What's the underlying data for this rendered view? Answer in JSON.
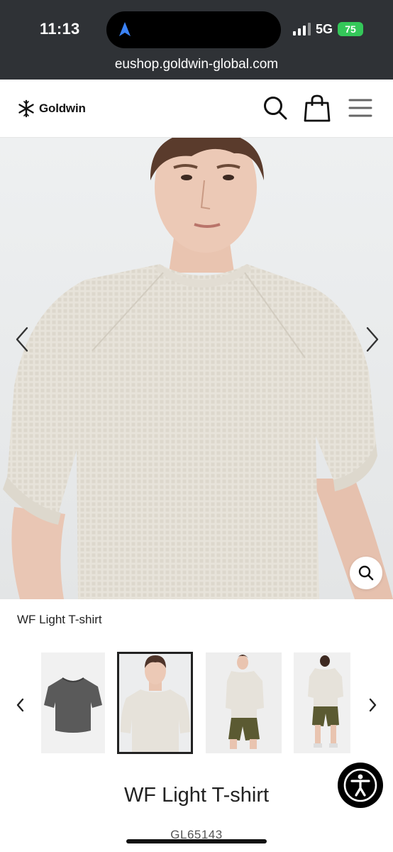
{
  "status_bar": {
    "time": "11:13",
    "network": "5G",
    "battery": "75",
    "url": "eushop.goldwin-global.com"
  },
  "header": {
    "logo_text": "Goldwin",
    "icons": [
      "snowflake-logo-icon",
      "search-icon",
      "shopping-bag-icon",
      "hamburger-menu-icon"
    ]
  },
  "hero": {
    "icons": [
      "chevron-left-icon",
      "chevron-right-icon",
      "zoom-icon"
    ]
  },
  "product": {
    "caption": "WF Light T-shirt",
    "title": "WF Light T-shirt",
    "code": "GL65143"
  },
  "thumbnails": {
    "count": 4,
    "selected_index": 1,
    "items": [
      "flat-lay-charcoal",
      "front-portrait-ivory",
      "side-full-body-ivory",
      "back-full-body-ivory"
    ]
  },
  "colors": {
    "status_bar_bg": "#2f3236",
    "battery_green": "#34c759",
    "text_dark": "#222222",
    "shirt_ivory": "#e6e2da",
    "shirt_charcoal": "#5a5a5a",
    "shorts_olive": "#5b5a32"
  }
}
